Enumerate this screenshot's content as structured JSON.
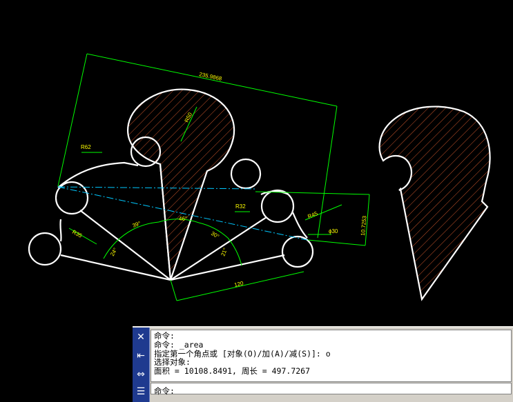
{
  "drawing": {
    "dimensions": {
      "aligned_length": "235.9868",
      "r50": "R50",
      "r62": "R62",
      "r32": "R32",
      "r45": "R45",
      "r35": "R35",
      "dia30": "ϕ30",
      "vertical": "10.7253",
      "ang_39": "39°",
      "ang_46": "46°",
      "ang_30": "30°",
      "ang_21": "21°",
      "ang_24": "24°",
      "len_120": "120"
    },
    "colors": {
      "background": "#000000",
      "geometry": "#ffffff",
      "dimension": "#00ff00",
      "dimension_text": "#ffff00",
      "hatch": "#ff6633",
      "construction": "#00c8ff"
    }
  },
  "command_window": {
    "history": [
      "命令:",
      "命令: _area",
      "指定第一个角点或 [对象(O)/加(A)/减(S)]: o",
      "选择对象:",
      "面积 = 10108.8491, 周长 = 497.7267"
    ],
    "prompt": "命令:",
    "toolbar_icons": [
      "close-icon",
      "dock-icon",
      "resize-icon",
      "properties-icon"
    ]
  }
}
